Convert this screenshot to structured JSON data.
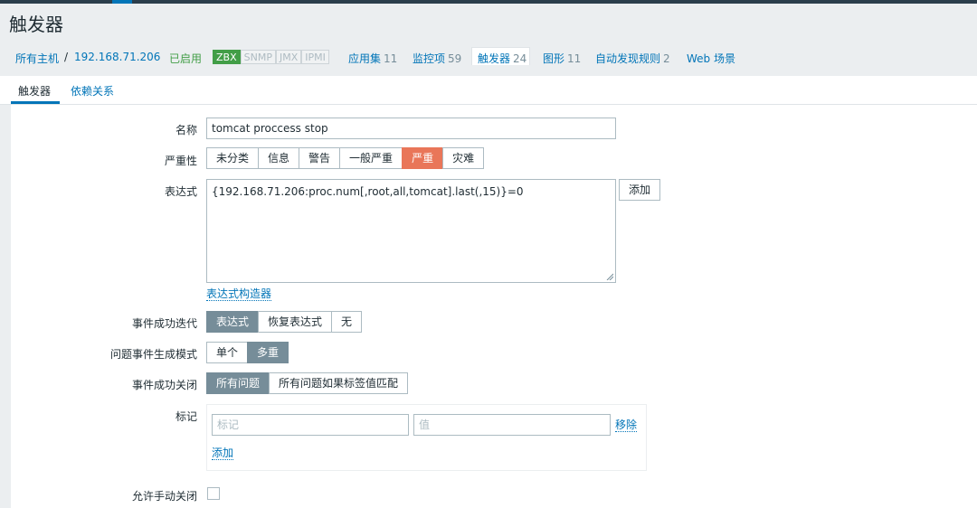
{
  "page": {
    "title": "触发器"
  },
  "breadcrumb": {
    "all_hosts": "所有主机",
    "separator": "/",
    "host": "192.168.71.206",
    "status": "已启用",
    "availability": [
      "ZBX",
      "SNMP",
      "JMX",
      "IPMI"
    ],
    "items": [
      {
        "label": "应用集",
        "count": "11"
      },
      {
        "label": "监控项",
        "count": "59"
      },
      {
        "label": "触发器",
        "count": "24"
      },
      {
        "label": "图形",
        "count": "11"
      },
      {
        "label": "自动发现规则",
        "count": "2"
      },
      {
        "label": "Web 场景",
        "count": ""
      }
    ]
  },
  "tabs": [
    "触发器",
    "依赖关系"
  ],
  "form": {
    "name_label": "名称",
    "name_value": "tomcat proccess stop",
    "severity_label": "严重性",
    "severity_options": [
      "未分类",
      "信息",
      "警告",
      "一般严重",
      "严重",
      "灾难"
    ],
    "severity_selected": "严重",
    "expression_label": "表达式",
    "expression_value": "{192.168.71.206:proc.num[,root,all,tomcat].last(,15)}=0",
    "add_button": "添加",
    "expression_builder_link": "表达式构造器",
    "ok_event_gen_label": "事件成功迭代",
    "ok_event_gen_options": [
      "表达式",
      "恢复表达式",
      "无"
    ],
    "problem_mode_label": "问题事件生成模式",
    "problem_mode_options": [
      "单个",
      "多重"
    ],
    "ok_close_label": "事件成功关闭",
    "ok_close_options": [
      "所有问题",
      "所有问题如果标签值匹配"
    ],
    "tags_label": "标记",
    "tag_placeholder": "标记",
    "value_placeholder": "值",
    "remove_link": "移除",
    "add_link": "添加",
    "manual_close_label": "允许手动关闭"
  },
  "colors": {
    "accent": "#0275b8",
    "selected_severity": "#e97659",
    "selected_segment": "#768d99",
    "enabled_green": "#429e47"
  }
}
